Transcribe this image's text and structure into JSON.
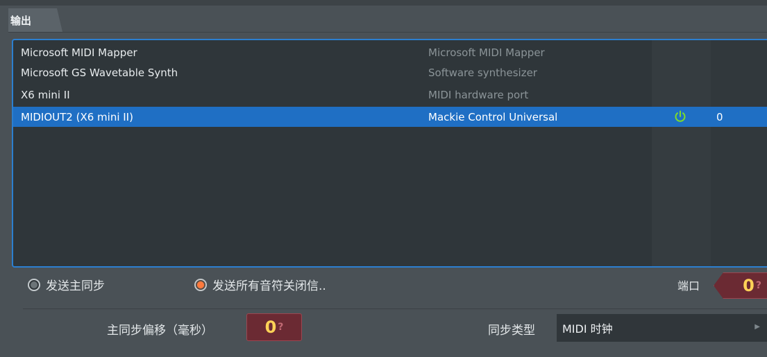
{
  "tab": {
    "label": "输出"
  },
  "devices": [
    {
      "name": "Microsoft MIDI Mapper",
      "controller": "Microsoft MIDI Mapper",
      "port": ""
    },
    {
      "name": "Microsoft GS Wavetable Synth",
      "controller": "Software synthesizer",
      "port": ""
    },
    {
      "name": "X6 mini II",
      "controller": "MIDI hardware port",
      "port": ""
    },
    {
      "name": "MIDIOUT2 (X6 mini II)",
      "controller": "Mackie Control Universal",
      "port": "0",
      "enabled": true,
      "selected": true
    }
  ],
  "options": {
    "send_master_sync": "发送主同步",
    "send_all_notes_off": "发送所有音符关闭信.."
  },
  "port": {
    "label": "端口",
    "value": "0"
  },
  "sync_offset": {
    "label": "主同步偏移（毫秒）",
    "value": "0"
  },
  "sync_type": {
    "label": "同步类型",
    "value": "MIDI 时钟"
  },
  "colors": {
    "accent": "#2c7fd0",
    "selected_row": "#1f6fc4",
    "power_on": "#7ddc2a",
    "radio_on": "#ff7a3d"
  }
}
